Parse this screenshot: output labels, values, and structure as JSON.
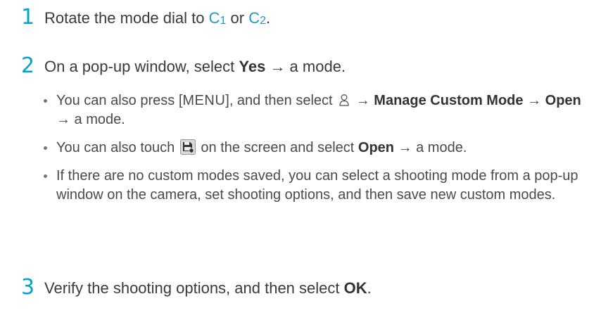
{
  "steps": [
    {
      "num": "1",
      "text_before": "Rotate the mode dial to ",
      "c1_letter": "C",
      "c1_sub": "1",
      "or": " or ",
      "c2_letter": "C",
      "c2_sub": "2",
      "end": "."
    },
    {
      "num": "2",
      "text_before": "On a pop-up window, select ",
      "bold": "Yes",
      "text_after": " → a mode."
    },
    {
      "num": "3",
      "text_before": "Verify the shooting options, and then select ",
      "bold": "OK",
      "end": "."
    }
  ],
  "bullets": [
    {
      "line1_a": "You can also press [",
      "menu": "MENU",
      "line1_b": "], and then select ",
      "icon": "person-icon",
      "arrow": " → ",
      "bold1": "Manage Custom Mode",
      "arrow2": " → ",
      "bold2": "Open",
      "tail": " → a mode."
    },
    {
      "a": "You can also touch ",
      "icon": "save-custom-mode-icon",
      "b": " on the screen and select ",
      "bold": "Open",
      "c": " → a mode."
    },
    {
      "text": "If there are no custom modes saved, you can select a shooting mode from a pop-up window on the camera, set shooting options, and then save new custom modes."
    }
  ],
  "colors": {
    "step_number": "#00a5c8",
    "mode_letter": "#1f9cc1"
  }
}
